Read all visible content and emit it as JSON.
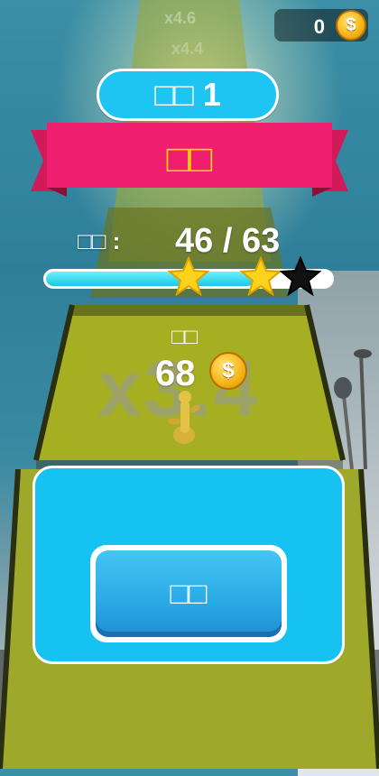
{
  "hud": {
    "coins": "0",
    "coin_symbol": "$"
  },
  "level": {
    "label": "□□ 1"
  },
  "banner": {
    "title": "□□"
  },
  "progress": {
    "label": "□□ :",
    "value": "46 / 63",
    "fraction": 0.73,
    "stars": [
      {
        "filled": true
      },
      {
        "filled": true
      },
      {
        "filled": false
      }
    ]
  },
  "reward": {
    "label": "□□",
    "multiplier": "x3.4",
    "amount": "68",
    "coin_symbol": "$"
  },
  "track_markers": [
    "x4.6",
    "x4.4"
  ],
  "action": {
    "button_label": "□□"
  },
  "colors": {
    "accent": "#1ec4f2",
    "ribbon": "#f01e6e",
    "track": "#9ea82a",
    "star": "#ffd21e"
  }
}
